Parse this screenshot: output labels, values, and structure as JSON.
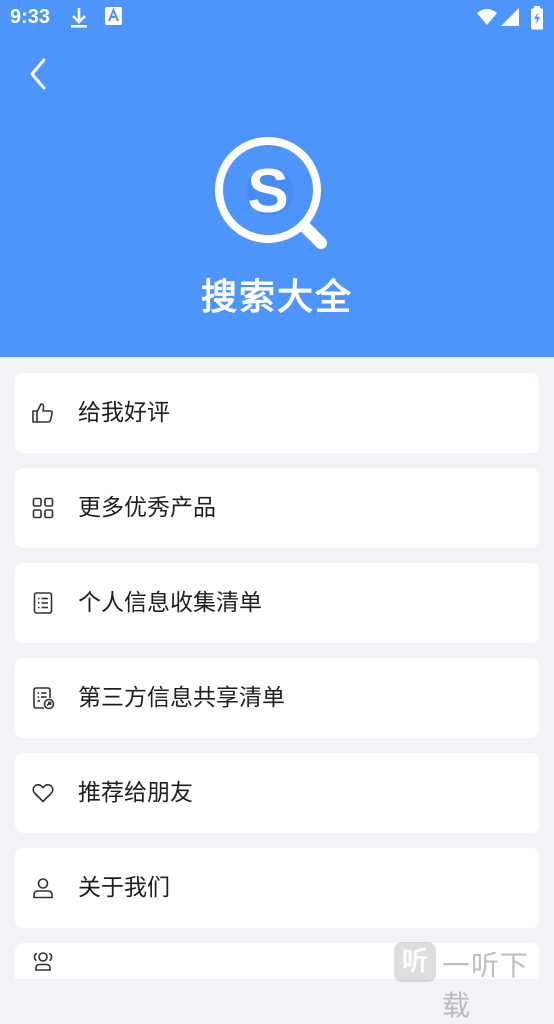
{
  "status_bar": {
    "time": "9:33",
    "icons": [
      "download-icon",
      "a-badge-icon",
      "wifi-icon",
      "signal-icon",
      "battery-icon"
    ]
  },
  "header": {
    "back_icon": "chevron-left-icon",
    "logo_icon": "search-s-logo-icon",
    "app_title": "搜索大全",
    "background_color": "#4d94fb"
  },
  "menu": {
    "items": [
      {
        "label": "给我好评",
        "icon": "thumbs-up-icon"
      },
      {
        "label": "更多优秀产品",
        "icon": "grid-icon"
      },
      {
        "label": "个人信息收集清单",
        "icon": "list-document-icon"
      },
      {
        "label": "第三方信息共享清单",
        "icon": "share-document-icon"
      },
      {
        "label": "推荐给朋友",
        "icon": "heart-icon"
      },
      {
        "label": "关于我们",
        "icon": "person-icon"
      },
      {
        "label": "",
        "icon": "group-icon"
      }
    ]
  },
  "watermark": {
    "badge": "听",
    "text": "一听下载"
  }
}
